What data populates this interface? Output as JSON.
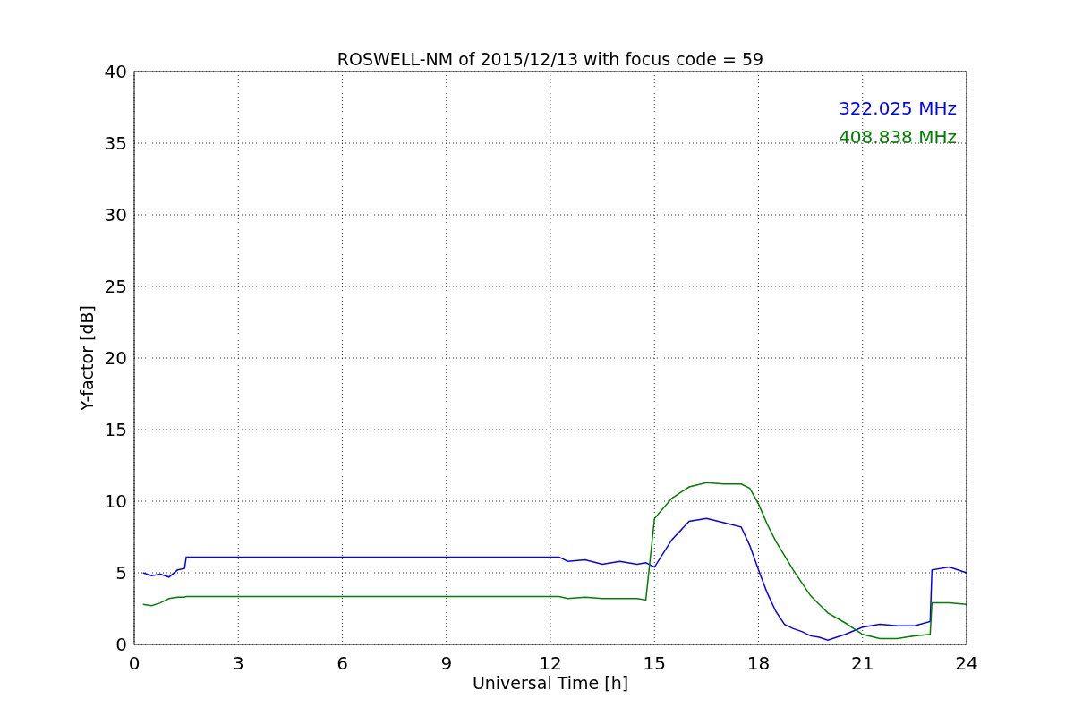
{
  "chart_data": {
    "type": "line",
    "title": "ROSWELL-NM of 2015/12/13 with focus code = 59",
    "xlabel": "Universal Time [h]",
    "ylabel": "Y-factor [dB]",
    "x": [
      0.25,
      0.5,
      0.75,
      1.0,
      1.25,
      1.45,
      1.5,
      12.25,
      12.5,
      13,
      13.5,
      14,
      14.5,
      14.75,
      15,
      15.5,
      16,
      16.5,
      17,
      17.5,
      17.75,
      18,
      18.25,
      18.5,
      18.75,
      19,
      19.25,
      19.5,
      19.75,
      20,
      20.5,
      21,
      21.5,
      22,
      22.5,
      22.95,
      23,
      23.5,
      24
    ],
    "series": [
      {
        "name": "322.025 MHz",
        "color": "#0000ff",
        "values": [
          5.0,
          4.8,
          4.9,
          4.7,
          5.2,
          5.3,
          6.1,
          6.1,
          5.8,
          5.9,
          5.6,
          5.8,
          5.6,
          5.7,
          5.4,
          7.3,
          8.6,
          8.8,
          8.5,
          8.2,
          6.9,
          5.2,
          3.6,
          2.3,
          1.4,
          1.1,
          0.9,
          0.6,
          0.5,
          0.3,
          0.7,
          1.2,
          1.4,
          1.3,
          1.3,
          1.6,
          5.2,
          5.4,
          5.0
        ]
      },
      {
        "name": "408.838 MHz",
        "color": "#008000",
        "values": [
          2.8,
          2.7,
          2.9,
          3.2,
          3.3,
          3.3,
          3.35,
          3.35,
          3.2,
          3.3,
          3.2,
          3.2,
          3.2,
          3.1,
          8.8,
          10.2,
          11.0,
          11.3,
          11.2,
          11.2,
          10.9,
          9.8,
          8.4,
          7.2,
          6.2,
          5.2,
          4.3,
          3.4,
          2.8,
          2.2,
          1.5,
          0.7,
          0.4,
          0.4,
          0.6,
          0.7,
          2.9,
          2.9,
          2.8
        ]
      }
    ],
    "xlim": [
      0,
      24
    ],
    "ylim": [
      0,
      40
    ],
    "xticks": [
      0,
      3,
      6,
      9,
      12,
      15,
      18,
      21,
      24
    ],
    "yticks": [
      0,
      5,
      10,
      15,
      20,
      25,
      30,
      35,
      40
    ],
    "grid": true
  }
}
